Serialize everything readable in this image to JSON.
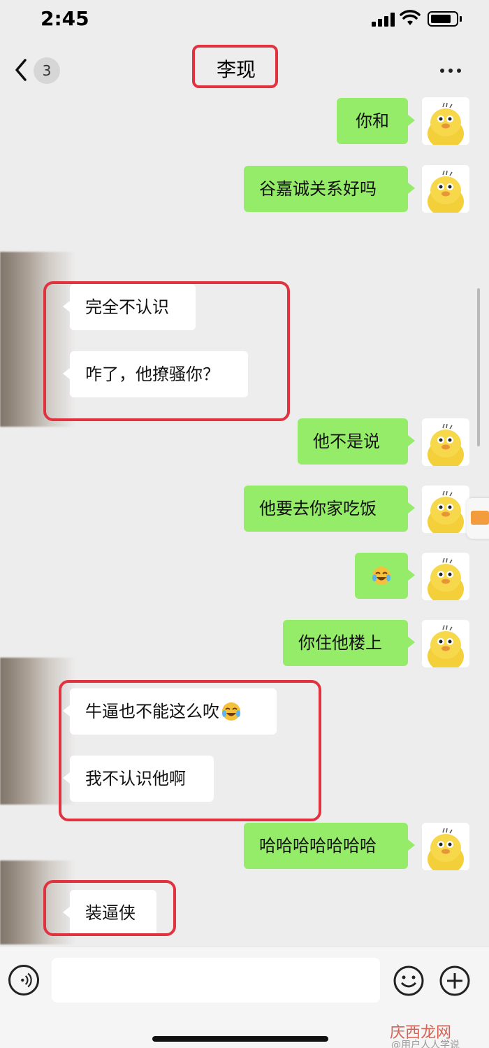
{
  "status_bar": {
    "time": "2:45"
  },
  "nav": {
    "unread_count": "3",
    "title": "李现"
  },
  "messages": [
    {
      "from": "me",
      "text": "你和"
    },
    {
      "from": "me",
      "text": "谷嘉诚关系好吗"
    },
    {
      "from": "them",
      "text": "完全不认识"
    },
    {
      "from": "them",
      "text": "咋了，他撩骚你？"
    },
    {
      "from": "me",
      "text": "他不是说"
    },
    {
      "from": "me",
      "text": "他要去你家吃饭"
    },
    {
      "from": "me",
      "text": "",
      "emoji": "laughing-crying-emoji"
    },
    {
      "from": "me",
      "text": "你住他楼上"
    },
    {
      "from": "them",
      "text": "牛逼也不能这么吹",
      "emoji": "laughing-crying-emoji"
    },
    {
      "from": "them",
      "text": "我不认识他啊"
    },
    {
      "from": "me",
      "text": "哈哈哈哈哈哈哈"
    },
    {
      "from": "them",
      "text": "装逼侠"
    }
  ],
  "watermark": {
    "text": "庆西龙网",
    "sub": "@用户人人学说"
  },
  "icons": {
    "back": "chevron-left-icon",
    "more": "more-dots-icon",
    "voice": "voice-icon",
    "emoji": "smiley-icon",
    "plus": "plus-icon",
    "mail": "mail-icon"
  },
  "colors": {
    "my_bubble": "#95ec69",
    "their_bubble": "#ffffff",
    "highlight": "#e0333f",
    "background": "#ededed"
  }
}
